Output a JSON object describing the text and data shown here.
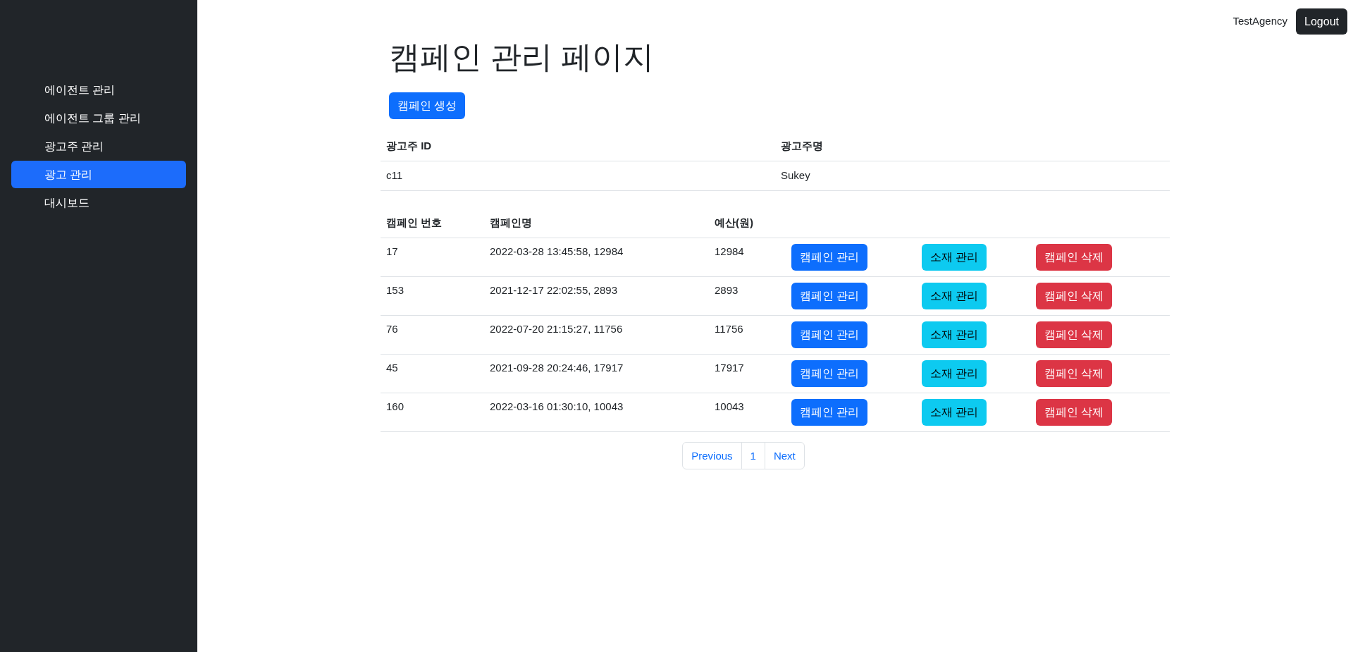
{
  "sidebar": {
    "items": [
      {
        "label": "에이전트 관리",
        "selected": false
      },
      {
        "label": "에이전트 그룹 관리",
        "selected": false
      },
      {
        "label": "광고주 관리",
        "selected": false
      },
      {
        "label": "광고 관리",
        "selected": true
      },
      {
        "label": "대시보드",
        "selected": false
      }
    ]
  },
  "header": {
    "user": "TestAgency",
    "logout": "Logout"
  },
  "title": "캠페인 관리 페이지",
  "create_button": "캠페인 생성",
  "advertiser_table": {
    "columns": [
      "광고주 ID",
      "광고주명"
    ],
    "rows": [
      [
        "c11",
        "Sukey"
      ]
    ]
  },
  "campaign_table": {
    "columns": [
      "캠페인 번호",
      "캠페인명",
      "예산(원)"
    ],
    "rows": [
      {
        "cells": [
          "17",
          "2022-03-28 13:45:58, 12984",
          "12984"
        ],
        "actions": [
          "캠페인 관리",
          "소재 관리",
          "캠페인 삭제"
        ]
      },
      {
        "cells": [
          "153",
          "2021-12-17 22:02:55, 2893",
          "2893"
        ],
        "actions": [
          "캠페인 관리",
          "소재 관리",
          "캠페인 삭제"
        ]
      },
      {
        "cells": [
          "76",
          "2022-07-20 21:15:27, 11756",
          "11756"
        ],
        "actions": [
          "캠페인 관리",
          "소재 관리",
          "캠페인 삭제"
        ]
      },
      {
        "cells": [
          "45",
          "2021-09-28 20:24:46, 17917",
          "17917"
        ],
        "actions": [
          "캠페인 관리",
          "소재 관리",
          "캠페인 삭제"
        ]
      },
      {
        "cells": [
          "160",
          "2022-03-16 01:30:10, 10043",
          "10043"
        ],
        "actions": [
          "캠페인 관리",
          "소재 관리",
          "캠페인 삭제"
        ]
      }
    ]
  },
  "pagination": {
    "previous": "Previous",
    "pages": [
      "1"
    ],
    "next": "Next"
  }
}
